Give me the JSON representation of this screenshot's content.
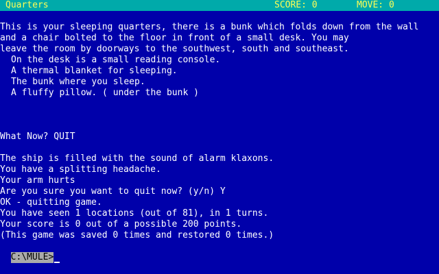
{
  "status": {
    "location": "Quarters",
    "score": "SCORE: 0",
    "move": "MOVE: 0"
  },
  "room_description": [
    "This is your sleeping quarters, there is a bunk which folds down from the wall",
    "and a chair bolted to the floor in front of a small desk. You may",
    "leave the room by doorways to the southwest, south and southeast."
  ],
  "room_items": [
    "On the desk is a small reading console.",
    "A thermal blanket for sleeping.",
    "The bunk where you sleep.",
    "A fluffy pillow. ( under the bunk )"
  ],
  "command": "What Now? QUIT",
  "output_lines": [
    "The ship is filled with the sound of alarm klaxons.",
    "You have a splitting headache.",
    "Your arm hurts",
    "Are you sure you want to quit now? (y/n) Y",
    "OK - quitting game.",
    "You have seen 1 locations (out of 81), in 1 turns.",
    "Your score is 0 out of a possible 200 points.",
    "(This game was saved 0 times and restored 0 times.)"
  ],
  "dos_prompt": "C:\\MULE>"
}
